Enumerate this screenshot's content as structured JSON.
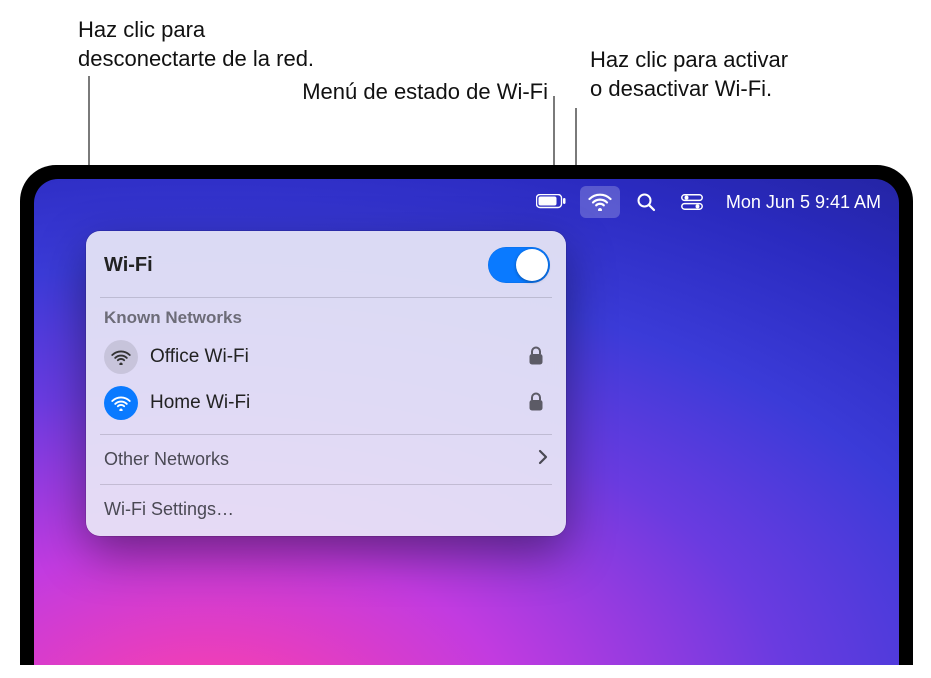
{
  "callouts": {
    "disconnect": "Haz clic para\ndesconectarte de la red.",
    "status_menu": "Menú de estado de Wi-Fi",
    "toggle": "Haz clic para activar\no desactivar Wi-Fi."
  },
  "menubar": {
    "datetime": "Mon Jun 5  9:41 AM"
  },
  "wifi_panel": {
    "title": "Wi-Fi",
    "toggle_on": true,
    "known_label": "Known Networks",
    "networks": [
      {
        "name": "Office Wi-Fi",
        "connected": false,
        "locked": true
      },
      {
        "name": "Home Wi-Fi",
        "connected": true,
        "locked": true
      }
    ],
    "other_label": "Other Networks",
    "settings_label": "Wi-Fi Settings…"
  }
}
